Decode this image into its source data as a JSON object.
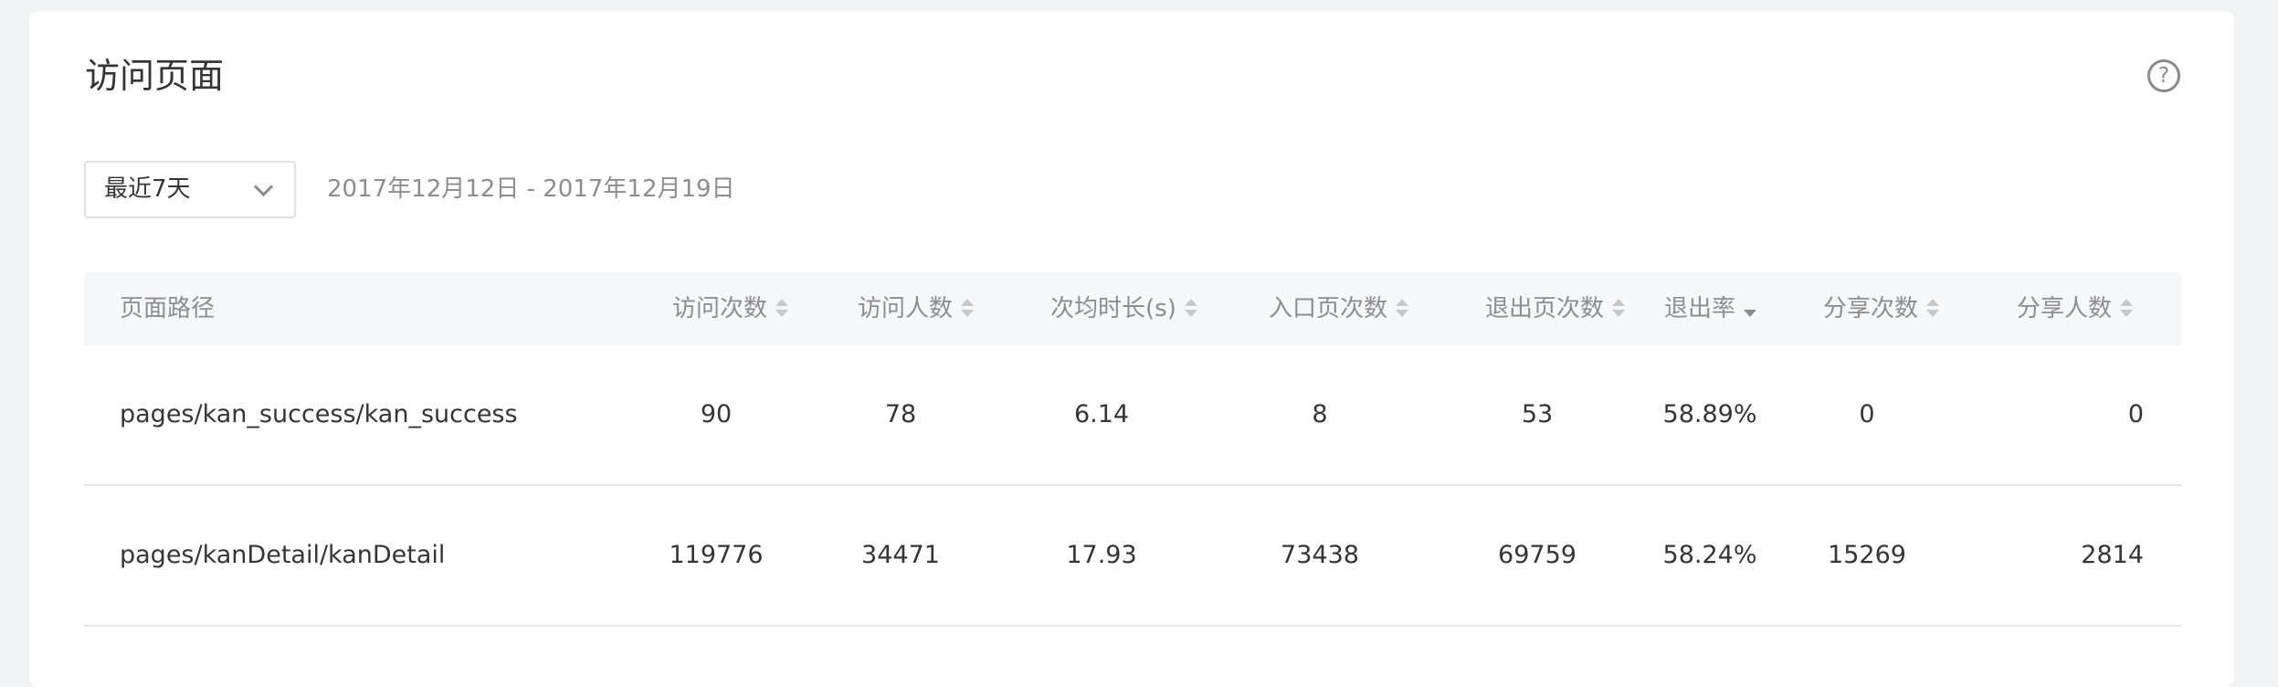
{
  "page": {
    "title": "访问页面",
    "help_icon": "question-circle-icon"
  },
  "filter": {
    "range_selected": "最近7天",
    "date_range": "2017年12月12日 - 2017年12月19日"
  },
  "table": {
    "columns": [
      {
        "key": "path",
        "label": "页面路径",
        "sortable": false
      },
      {
        "key": "visits",
        "label": "访问次数",
        "sortable": true,
        "sort": "none"
      },
      {
        "key": "visitors",
        "label": "访问人数",
        "sortable": true,
        "sort": "none"
      },
      {
        "key": "avg_duration",
        "label": "次均时长(s)",
        "sortable": true,
        "sort": "none"
      },
      {
        "key": "entry_count",
        "label": "入口页次数",
        "sortable": true,
        "sort": "none"
      },
      {
        "key": "exit_count",
        "label": "退出页次数",
        "sortable": true,
        "sort": "none"
      },
      {
        "key": "exit_rate",
        "label": "退出率",
        "sortable": true,
        "sort": "desc"
      },
      {
        "key": "share_count",
        "label": "分享次数",
        "sortable": true,
        "sort": "none"
      },
      {
        "key": "share_users",
        "label": "分享人数",
        "sortable": true,
        "sort": "none"
      }
    ],
    "rows": [
      [
        "pages/kan_success/kan_success",
        "90",
        "78",
        "6.14",
        "8",
        "53",
        "58.89%",
        "0",
        "0"
      ],
      [
        "pages/kanDetail/kanDetail",
        "119776",
        "34471",
        "17.93",
        "73438",
        "69759",
        "58.24%",
        "15269",
        "2814"
      ]
    ]
  },
  "colors": {
    "background": "#f2f3f5",
    "card": "#ffffff",
    "header_bg": "#f6f7f9",
    "muted_text": "#8d8d8d",
    "text": "#353535",
    "sort_inactive": "#c8c8c8",
    "sort_active": "#8a8a8a"
  }
}
